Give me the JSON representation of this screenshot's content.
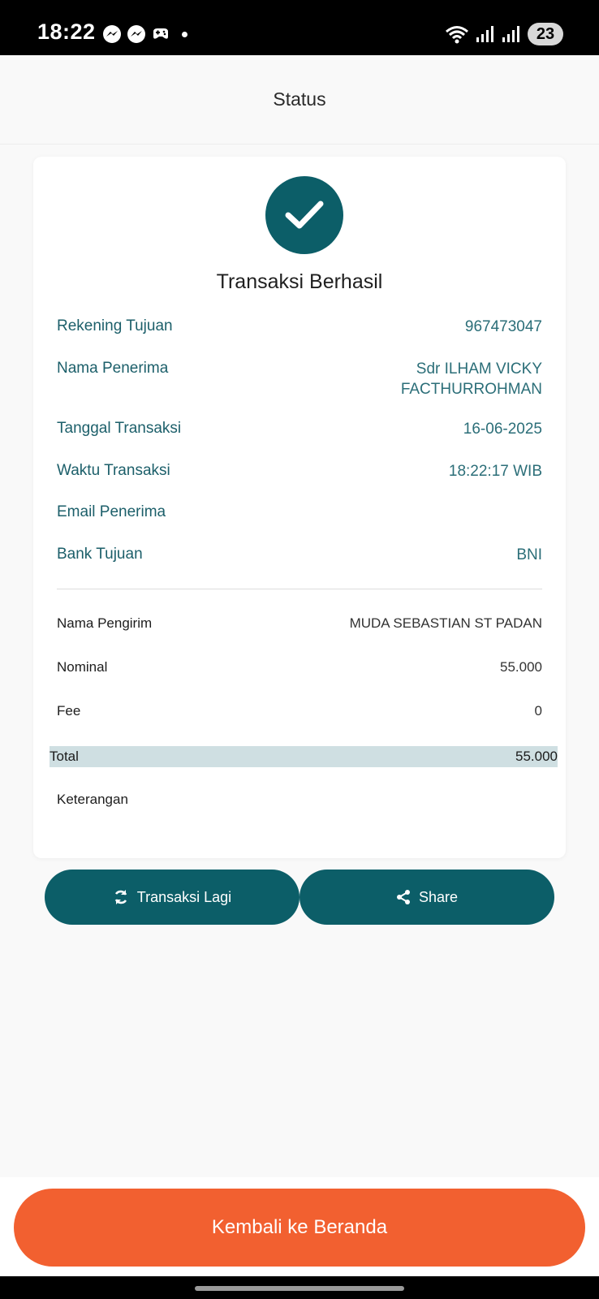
{
  "status_bar": {
    "time": "18:22",
    "battery": "23",
    "notification_icons": [
      "messenger-icon",
      "messenger-icon",
      "game-controller-icon"
    ],
    "system_icons": [
      "wifi-icon",
      "signal-icon",
      "signal-icon"
    ]
  },
  "header": {
    "title": "Status"
  },
  "result": {
    "title": "Transaksi Berhasil",
    "icon": "checkmark-icon"
  },
  "details": [
    {
      "label": "Rekening Tujuan",
      "value": "967473047"
    },
    {
      "label": "Nama Penerima",
      "value": "Sdr ILHAM VICKY",
      "value2": "FACTHURROHMAN"
    },
    {
      "label": "Tanggal Transaksi",
      "value": "16-06-2025"
    },
    {
      "label": "Waktu Transaksi",
      "value": "18:22:17 WIB"
    },
    {
      "label": "Email Penerima",
      "value": ""
    },
    {
      "label": "Bank Tujuan",
      "value": "BNI"
    }
  ],
  "summary": {
    "sender_label": "Nama Pengirim",
    "sender_value": "MUDA SEBASTIAN ST PADAN",
    "nominal_label": "Nominal",
    "nominal_value": "55.000",
    "fee_label": "Fee",
    "fee_value": "0",
    "total_label": "Total",
    "total_value": "55.000",
    "note_label": "Keterangan",
    "note_value": ""
  },
  "actions": {
    "again_label": "Transaksi Lagi",
    "again_icon": "refresh-icon",
    "share_label": "Share",
    "share_icon": "share-icon"
  },
  "footer": {
    "home_label": "Kembali ke Beranda"
  },
  "colors": {
    "primary": "#0c5e68",
    "accent": "#f26030",
    "total_bg": "#cfdfe2"
  }
}
